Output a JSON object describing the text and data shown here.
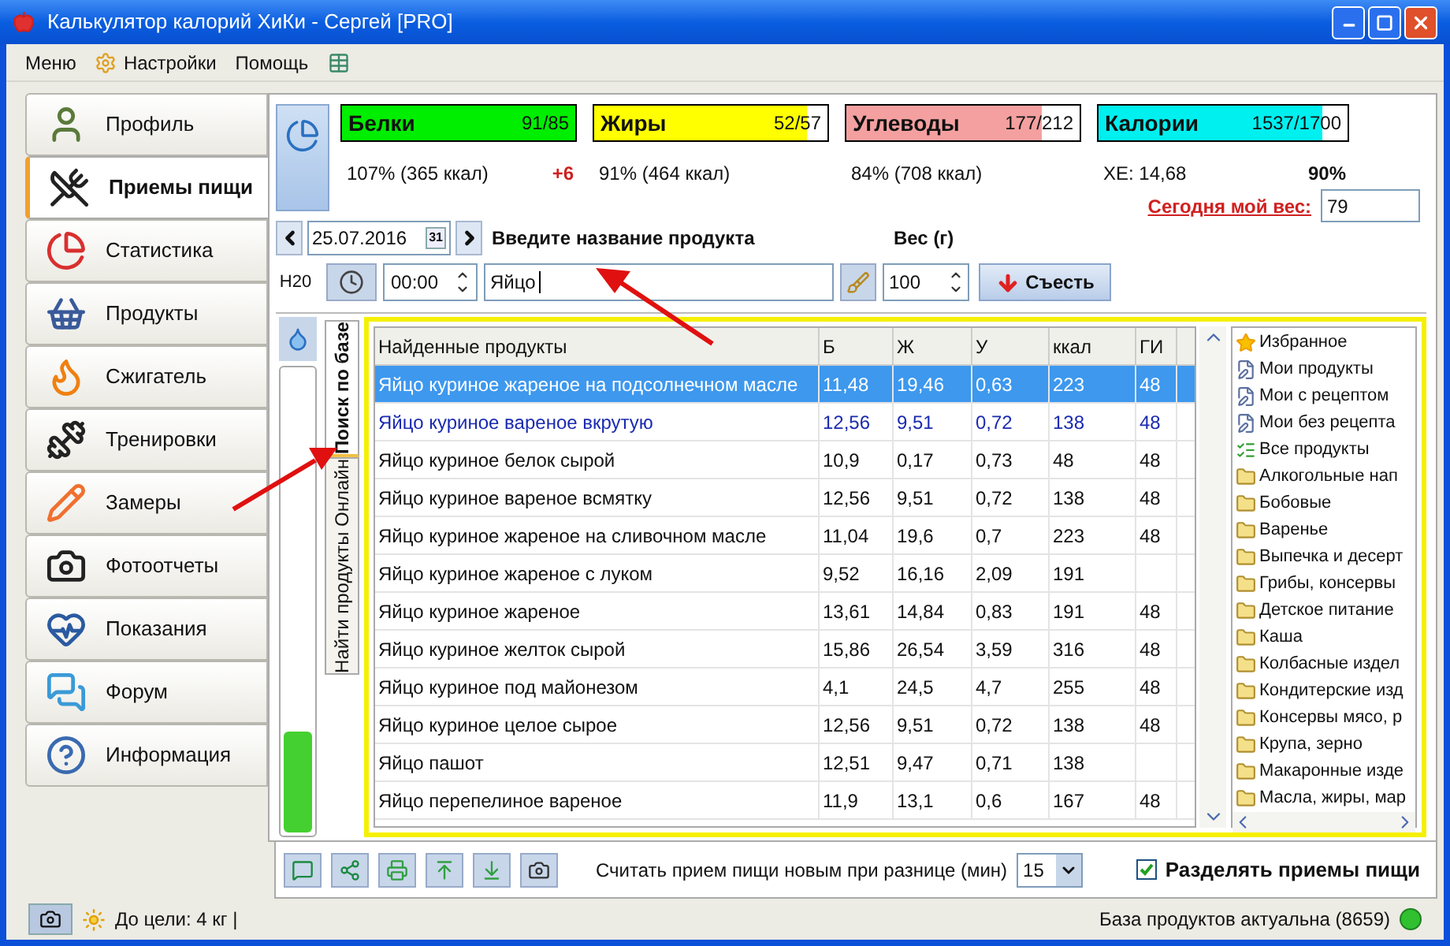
{
  "window": {
    "title": "Калькулятор калорий ХиКи - Сергей [PRO]"
  },
  "menu": [
    "Меню",
    "Настройки",
    "Помощь"
  ],
  "nav": [
    {
      "label": "Профиль",
      "selected": false
    },
    {
      "label": "Приемы пищи",
      "selected": true
    },
    {
      "label": "Статистика",
      "selected": false
    },
    {
      "label": "Продукты",
      "selected": false
    },
    {
      "label": "Сжигатель",
      "selected": false
    },
    {
      "label": "Тренировки",
      "selected": false
    },
    {
      "label": "Замеры",
      "selected": false
    },
    {
      "label": "Фотоотчеты",
      "selected": false
    },
    {
      "label": "Показания",
      "selected": false
    },
    {
      "label": "Форум",
      "selected": false
    },
    {
      "label": "Информация",
      "selected": false
    }
  ],
  "macros": [
    {
      "name": "Белки",
      "reading": "91/85",
      "level": 1,
      "color": "#00ee00",
      "summary": "107% (365 ккал)",
      "excess": "+6"
    },
    {
      "name": "Жиры",
      "reading": "52/57",
      "level": 0.91,
      "color": "#ffff00",
      "summary": "91% (464 ккал)"
    },
    {
      "name": "Углеводы",
      "reading": "177/212",
      "level": 0.84,
      "color": "#f4a0a0",
      "summary": "84% (708 ккал)"
    },
    {
      "name": "Калории",
      "reading": "1537/1700",
      "level": 0.9,
      "color": "#00f0f0",
      "summary": "ХЕ: 14,68",
      "percent": "90%"
    }
  ],
  "weight_today": {
    "label": "Сегодня мой вес:",
    "value": "79"
  },
  "date": "25.07.2016",
  "calendar_day": "31",
  "product_label": "Введите название продукта",
  "weight_label": "Вес (г)",
  "water": {
    "label": "H20",
    "level": 0.22
  },
  "time": "00:00",
  "search": {
    "value": "Яйцо"
  },
  "weight": "100",
  "eat_button": "Съесть",
  "source_tabs": [
    {
      "label": "Поиск по базе",
      "selected": true
    },
    {
      "label": "Найти продукты Онлайн",
      "selected": false
    }
  ],
  "table": {
    "columns": [
      "Найденные продукты",
      "Б",
      "Ж",
      "У",
      "ккал",
      "ГИ"
    ],
    "rows": [
      {
        "cells": [
          "Яйцо куриное жареное на подсолнечном масле",
          "11,48",
          "19,46",
          "0,63",
          "223",
          "48"
        ],
        "selected": true,
        "highlighted": false
      },
      {
        "cells": [
          "Яйцо куриное вареное вкрутую",
          "12,56",
          "9,51",
          "0,72",
          "138",
          "48"
        ],
        "selected": false,
        "highlighted": true
      },
      {
        "cells": [
          "Яйцо куриное белок сырой",
          "10,9",
          "0,17",
          "0,73",
          "48",
          "48"
        ],
        "selected": false,
        "highlighted": false
      },
      {
        "cells": [
          "Яйцо куриное вареное всмятку",
          "12,56",
          "9,51",
          "0,72",
          "138",
          "48"
        ],
        "selected": false,
        "highlighted": false
      },
      {
        "cells": [
          "Яйцо куриное жареное на сливочном масле",
          "11,04",
          "19,6",
          "0,7",
          "223",
          "48"
        ],
        "selected": false,
        "highlighted": false
      },
      {
        "cells": [
          "Яйцо куриное жареное с луком",
          "9,52",
          "16,16",
          "2,09",
          "191",
          ""
        ],
        "selected": false,
        "highlighted": false
      },
      {
        "cells": [
          "Яйцо куриное жареное",
          "13,61",
          "14,84",
          "0,83",
          "191",
          "48"
        ],
        "selected": false,
        "highlighted": false
      },
      {
        "cells": [
          "Яйцо куриное желток сырой",
          "15,86",
          "26,54",
          "3,59",
          "316",
          "48"
        ],
        "selected": false,
        "highlighted": false
      },
      {
        "cells": [
          "Яйцо куриное под майонезом",
          "4,1",
          "24,5",
          "4,7",
          "255",
          "48"
        ],
        "selected": false,
        "highlighted": false
      },
      {
        "cells": [
          "Яйцо куриное целое сырое",
          "12,56",
          "9,51",
          "0,72",
          "138",
          "48"
        ],
        "selected": false,
        "highlighted": false
      },
      {
        "cells": [
          "Яйцо пашот",
          "12,51",
          "9,47",
          "0,71",
          "138",
          ""
        ],
        "selected": false,
        "highlighted": false
      },
      {
        "cells": [
          "Яйцо перепелиное вареное",
          "11,9",
          "13,1",
          "0,6",
          "167",
          "48"
        ],
        "selected": false,
        "highlighted": false
      }
    ]
  },
  "categories": [
    {
      "label": "Избранное",
      "kind": "favorite"
    },
    {
      "label": "Мои продукты",
      "kind": "mine"
    },
    {
      "label": "Мои с рецептом",
      "kind": "mine"
    },
    {
      "label": "Мои без рецепта",
      "kind": "mine"
    },
    {
      "label": "Все продукты",
      "kind": "all"
    },
    {
      "label": "Алкогольные нап",
      "kind": "folder"
    },
    {
      "label": "Бобовые",
      "kind": "folder"
    },
    {
      "label": "Варенье",
      "kind": "folder"
    },
    {
      "label": "Выпечка и десерт",
      "kind": "folder"
    },
    {
      "label": "Грибы, консервы",
      "kind": "folder"
    },
    {
      "label": "Детское питание",
      "kind": "folder"
    },
    {
      "label": "Каша",
      "kind": "folder"
    },
    {
      "label": "Колбасные издел",
      "kind": "folder"
    },
    {
      "label": "Кондитерские изд",
      "kind": "folder"
    },
    {
      "label": "Консервы мясо, р",
      "kind": "folder"
    },
    {
      "label": "Крупа, зерно",
      "kind": "folder"
    },
    {
      "label": "Макаронные изде",
      "kind": "folder"
    },
    {
      "label": "Масла, жиры, мар",
      "kind": "folder"
    }
  ],
  "toolbar": {
    "label": "Считать прием пищи новым при разнице (мин)",
    "interval": "15",
    "split": {
      "label": "Разделять приемы пищи",
      "checked": true
    }
  },
  "status_bar": {
    "goal": "До цели: 4 кг |",
    "database": "База продуктов актуальна (8659)"
  }
}
